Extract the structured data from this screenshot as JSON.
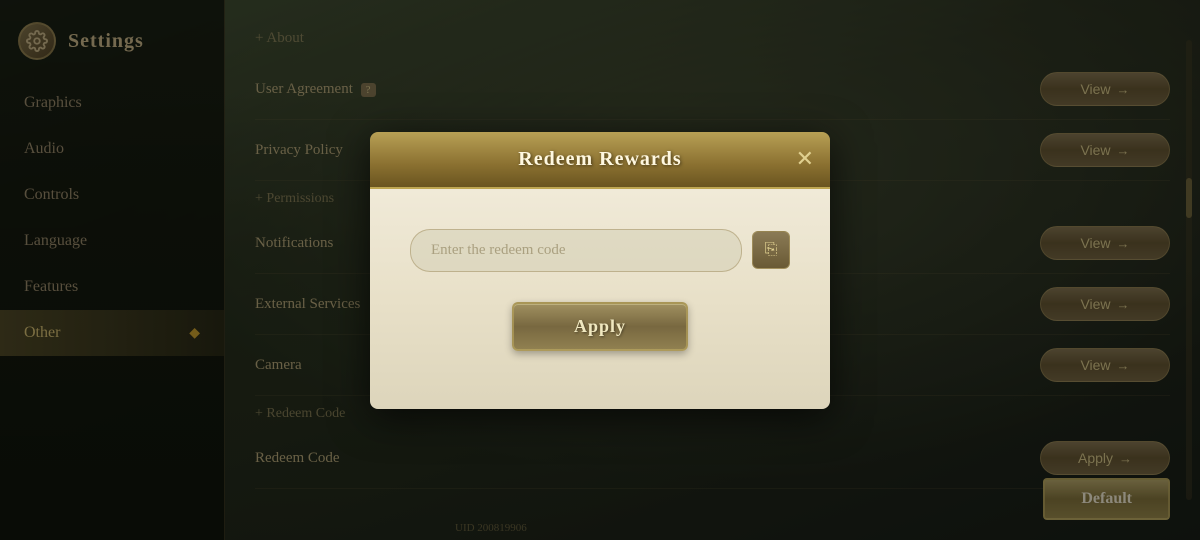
{
  "app": {
    "title": "Settings"
  },
  "sidebar": {
    "items": [
      {
        "id": "graphics",
        "label": "Graphics",
        "active": false
      },
      {
        "id": "audio",
        "label": "Audio",
        "active": false
      },
      {
        "id": "controls",
        "label": "Controls",
        "active": false
      },
      {
        "id": "language",
        "label": "Language",
        "active": false
      },
      {
        "id": "features",
        "label": "Features",
        "active": false
      },
      {
        "id": "other",
        "label": "Other",
        "active": true
      }
    ]
  },
  "main": {
    "sections": [
      {
        "type": "header",
        "text": "About"
      },
      {
        "type": "row",
        "label": "User Agreement",
        "badge": "?",
        "button": "View →"
      },
      {
        "type": "row",
        "label": "Privacy Policy",
        "button": "View →"
      },
      {
        "type": "subheader",
        "text": "Permissions"
      },
      {
        "type": "row",
        "label": "Notifications",
        "button": "View →"
      },
      {
        "type": "row",
        "label": "External Services",
        "button": "View →"
      },
      {
        "type": "row",
        "label": "Camera",
        "button": "View →"
      },
      {
        "type": "subheader",
        "text": "Redeem Code"
      },
      {
        "type": "row",
        "label": "Redeem Code",
        "button": "Apply →"
      }
    ]
  },
  "modal": {
    "title": "Redeem Rewards",
    "close_label": "✕",
    "input_placeholder": "Enter the redeem code",
    "apply_label": "Apply"
  },
  "footer": {
    "uid": "UID 200819906",
    "default_btn": "Default"
  }
}
